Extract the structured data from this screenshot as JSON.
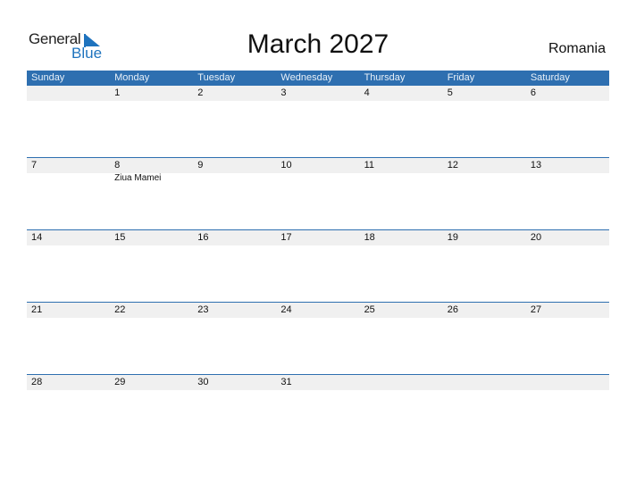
{
  "logo": {
    "general": "General",
    "blue": "Blue"
  },
  "title": "March 2027",
  "country": "Romania",
  "colors": {
    "accent": "#2e6fb0",
    "strip": "#f0f0f0"
  },
  "weekdays": [
    "Sunday",
    "Monday",
    "Tuesday",
    "Wednesday",
    "Thursday",
    "Friday",
    "Saturday"
  ],
  "weeks": [
    {
      "days": [
        "",
        "1",
        "2",
        "3",
        "4",
        "5",
        "6"
      ],
      "notes": [
        "",
        "",
        "",
        "",
        "",
        "",
        ""
      ]
    },
    {
      "days": [
        "7",
        "8",
        "9",
        "10",
        "11",
        "12",
        "13"
      ],
      "notes": [
        "",
        "Ziua Mamei",
        "",
        "",
        "",
        "",
        ""
      ]
    },
    {
      "days": [
        "14",
        "15",
        "16",
        "17",
        "18",
        "19",
        "20"
      ],
      "notes": [
        "",
        "",
        "",
        "",
        "",
        "",
        ""
      ]
    },
    {
      "days": [
        "21",
        "22",
        "23",
        "24",
        "25",
        "26",
        "27"
      ],
      "notes": [
        "",
        "",
        "",
        "",
        "",
        "",
        ""
      ]
    },
    {
      "days": [
        "28",
        "29",
        "30",
        "31",
        "",
        "",
        ""
      ],
      "notes": [
        "",
        "",
        "",
        "",
        "",
        "",
        ""
      ]
    }
  ]
}
